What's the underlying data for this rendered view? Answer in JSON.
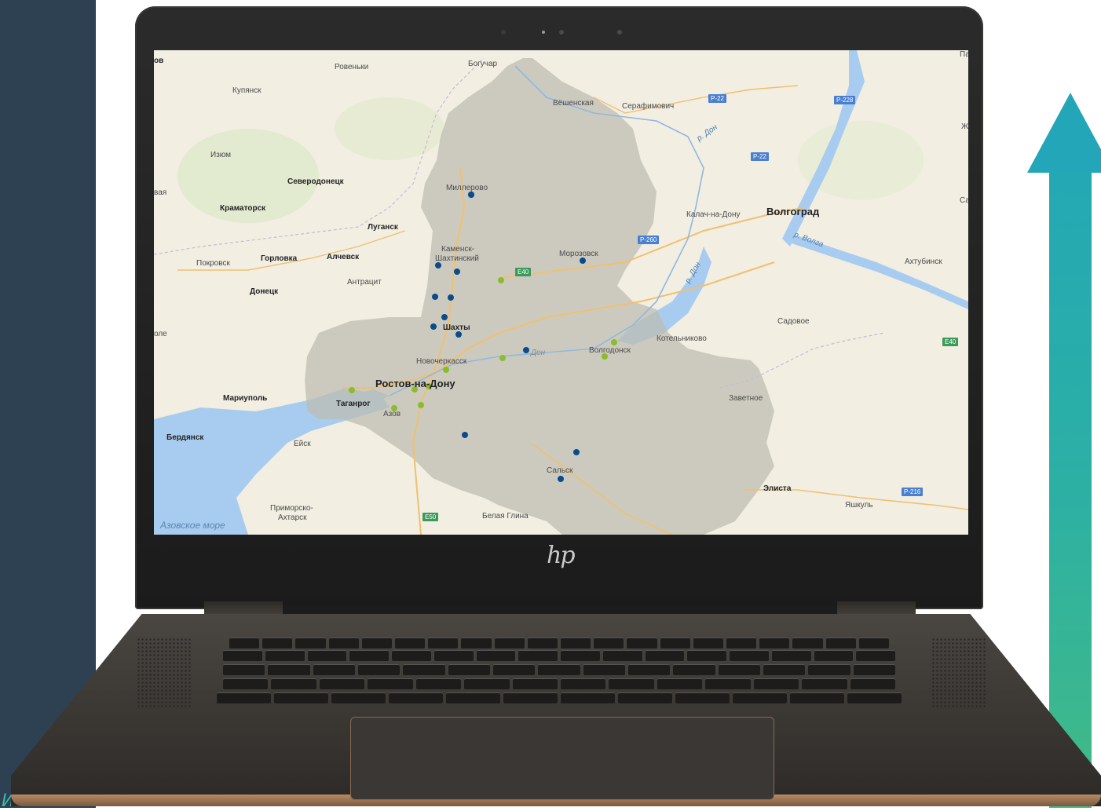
{
  "map": {
    "sea_label": "Азовское море",
    "cities": [
      {
        "name": "Ровеньки",
        "style": "lbl"
      },
      {
        "name": "Богучар",
        "style": "lbl"
      },
      {
        "name": "Купянск",
        "style": "lbl"
      },
      {
        "name": "Вёшенская",
        "style": "lbl"
      },
      {
        "name": "Серафимович",
        "style": "lbl"
      },
      {
        "name": "Изюм",
        "style": "lbl"
      },
      {
        "name": "Северодонецк",
        "style": "lbl-b"
      },
      {
        "name": "Миллерово",
        "style": "lbl"
      },
      {
        "name": "Краматорск",
        "style": "lbl-b"
      },
      {
        "name": "Луганск",
        "style": "lbl-b"
      },
      {
        "name": "Калач-на-Дону",
        "style": "lbl"
      },
      {
        "name": "Волгоград",
        "style": "lbl-big"
      },
      {
        "name": "Покровск",
        "style": "lbl"
      },
      {
        "name": "Горловка",
        "style": "lbl-b"
      },
      {
        "name": "Алчевск",
        "style": "lbl-b"
      },
      {
        "name": "Каменск-",
        "style": "lbl"
      },
      {
        "name": "Шахтинский",
        "style": "lbl"
      },
      {
        "name": "Морозовск",
        "style": "lbl"
      },
      {
        "name": "Ахтубинск",
        "style": "lbl"
      },
      {
        "name": "Антрацит",
        "style": "lbl"
      },
      {
        "name": "Донецк",
        "style": "lbl-b"
      },
      {
        "name": "Шахты",
        "style": "lbl-b"
      },
      {
        "name": "Садовое",
        "style": "lbl"
      },
      {
        "name": "Котельниково",
        "style": "lbl"
      },
      {
        "name": "Волгодонск",
        "style": "lbl"
      },
      {
        "name": "Новочеркасск",
        "style": "lbl"
      },
      {
        "name": "Ростов-на-Дону",
        "style": "lbl-big"
      },
      {
        "name": "Мариуполь",
        "style": "lbl-b"
      },
      {
        "name": "Таганрог",
        "style": "lbl-b"
      },
      {
        "name": "Азов",
        "style": "lbl"
      },
      {
        "name": "Заветное",
        "style": "lbl"
      },
      {
        "name": "Бердянск",
        "style": "lbl-b"
      },
      {
        "name": "Ейск",
        "style": "lbl"
      },
      {
        "name": "Сальск",
        "style": "lbl"
      },
      {
        "name": "Элиста",
        "style": "lbl-b"
      },
      {
        "name": "Яшкуль",
        "style": "lbl"
      },
      {
        "name": "Приморско-",
        "style": "lbl"
      },
      {
        "name": "Ахтарск",
        "style": "lbl"
      },
      {
        "name": "Белая Глина",
        "style": "lbl"
      }
    ],
    "rivers": [
      "р. Дон",
      "р. Дон",
      "р. Волга",
      "Дон"
    ],
    "road_shields": [
      {
        "label": "P-22",
        "color": "#4a7fd0"
      },
      {
        "label": "P-228",
        "color": "#4a7fd0"
      },
      {
        "label": "P-22",
        "color": "#4a7fd0"
      },
      {
        "label": "P-260",
        "color": "#4a7fd0"
      },
      {
        "label": "E40",
        "color": "#3a9a5a"
      },
      {
        "label": "E40",
        "color": "#3a9a5a"
      },
      {
        "label": "E50",
        "color": "#3a9a5a"
      },
      {
        "label": "P-216",
        "color": "#4a7fd0"
      }
    ],
    "edge_fragments": [
      "ов",
      "вая",
      "оле",
      "Ж",
      "Са",
      "Па"
    ],
    "marker_colors": {
      "blue": "#0a4b8c",
      "green": "#8cbc2a"
    },
    "markers_blue_count": 14,
    "markers_green_count": 10
  },
  "laptop": {
    "brand_logo": "hp"
  }
}
